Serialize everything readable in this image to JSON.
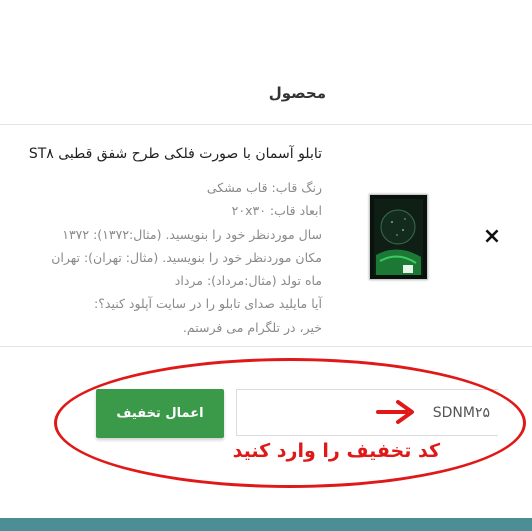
{
  "header": {
    "title": "محصول"
  },
  "cart_item": {
    "name": "تابلو آسمان با صورت فلکی طرح شفق قطبی ST۸",
    "meta": [
      "رنگ قاب: قاب مشکی",
      "ابعاد قاب: ۲۰x۳۰",
      "سال موردنظر خود را بنویسید. (مثال:۱۳۷۲): ۱۳۷۲",
      "مکان موردنظر خود را بنویسید. (مثال: تهران): تهران",
      "ماه تولد (مثال:مرداد): مرداد",
      "آیا مایلید صدای تابلو را در سایت آپلود کنید؟:",
      "خیر، در تلگرام می فرستم."
    ],
    "thumbnail_icon": "framed-poster-image",
    "remove_icon": "close-icon",
    "remove_glyph": "×"
  },
  "coupon": {
    "value": "SDNM۲۵",
    "apply_label": "اعمال تخفیف",
    "annotation": "کد تخفیف را وارد کنید"
  },
  "colors": {
    "apply_button": "#3a9a4a",
    "annotation": "#e01818",
    "footer": "#4b8e93"
  }
}
